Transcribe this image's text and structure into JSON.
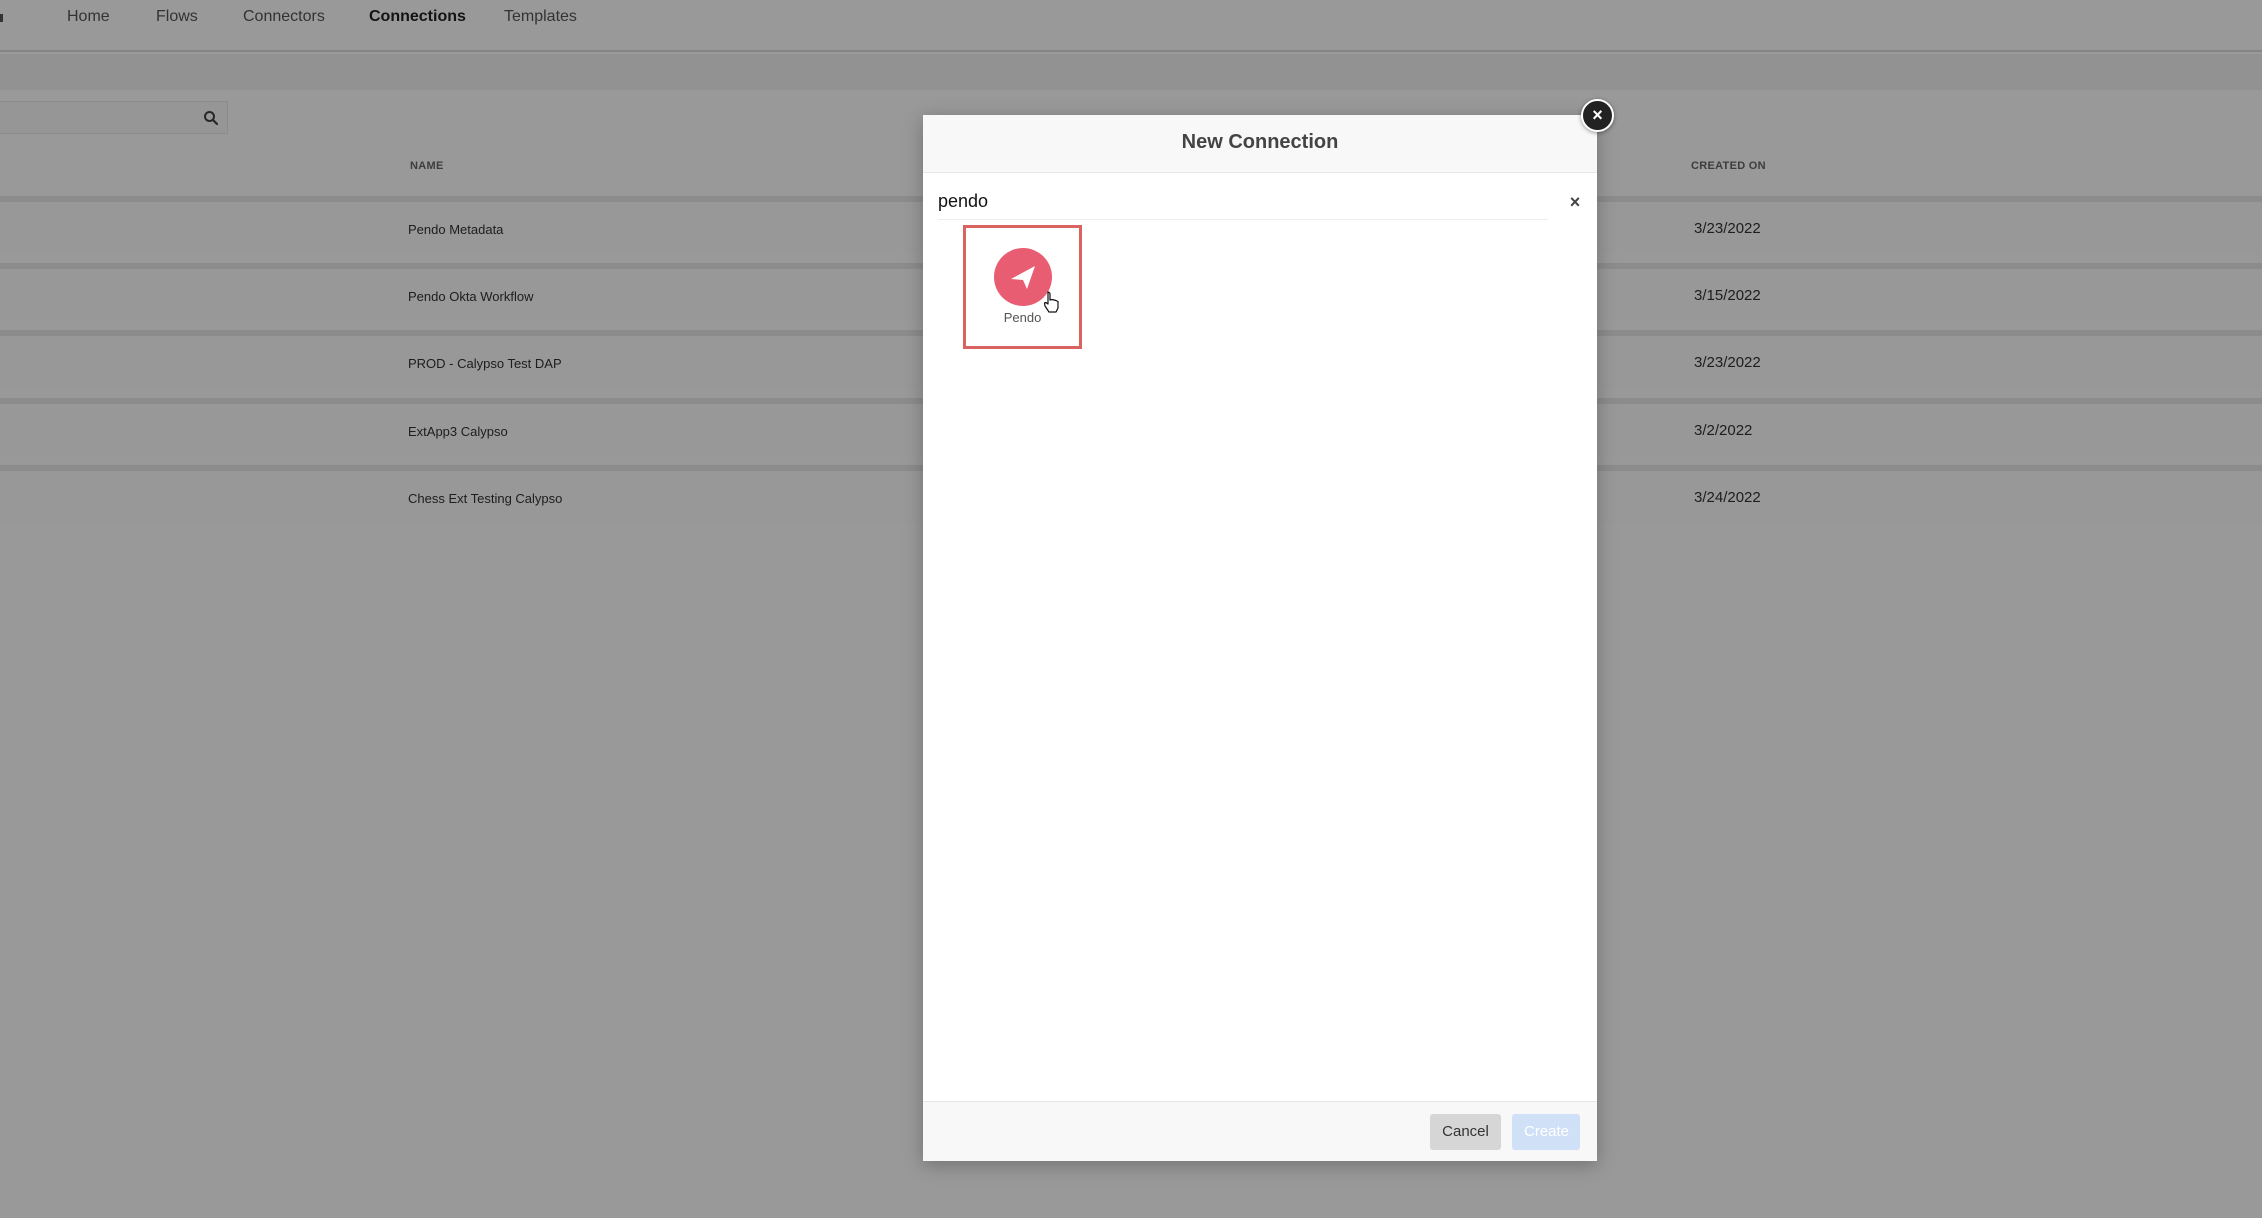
{
  "topnav": {
    "items": [
      {
        "label": "Home",
        "active": false
      },
      {
        "label": "Flows",
        "active": false
      },
      {
        "label": "Connectors",
        "active": false
      },
      {
        "label": "Connections",
        "active": true
      },
      {
        "label": "Templates",
        "active": false
      }
    ]
  },
  "table": {
    "columns": {
      "name": "NAME",
      "created_on": "CREATED ON"
    },
    "rows": [
      {
        "name": "Pendo Metadata",
        "created_on": "3/23/2022"
      },
      {
        "name": "Pendo Okta Workflow",
        "created_on": "3/15/2022"
      },
      {
        "name": "PROD - Calypso Test DAP",
        "created_on": "3/23/2022"
      },
      {
        "name": "ExtApp3 Calypso",
        "created_on": "3/2/2022"
      },
      {
        "name": "Chess Ext Testing Calypso",
        "created_on": "3/24/2022"
      }
    ]
  },
  "modal": {
    "title": "New Connection",
    "search_value": "pendo",
    "results": [
      {
        "label": "Pendo",
        "icon": "pendo-logo-icon",
        "color": "#e85d71",
        "highlighted": true
      }
    ],
    "cancel_label": "Cancel",
    "create_label": "Create"
  },
  "colors": {
    "highlight_border": "#d9645f",
    "pendo_brand": "#e85d71",
    "create_disabled": "#cfe0f7",
    "cancel_bg": "#d6d6d6"
  }
}
